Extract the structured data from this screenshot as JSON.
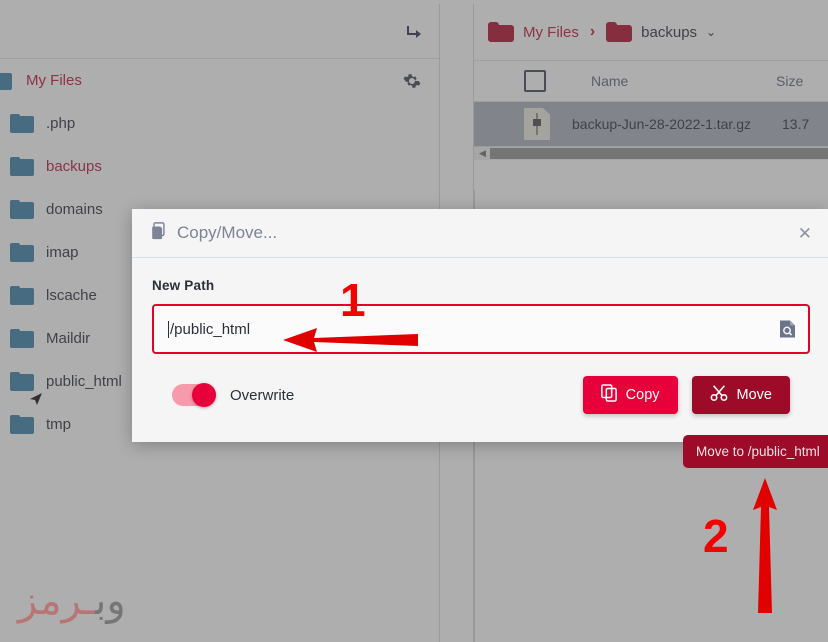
{
  "left_panel": {
    "collapse_icon": "arrow-turn-down-right-icon",
    "gear_icon": "gear-icon",
    "tree": [
      {
        "label": "My Files",
        "icon": "folder-icon",
        "style": "red",
        "root": true
      },
      {
        "label": ".php",
        "icon": "folder-icon",
        "style": "dark"
      },
      {
        "label": "backups",
        "icon": "folder-icon",
        "style": "red"
      },
      {
        "label": "domains",
        "icon": "folder-icon",
        "style": "dark"
      },
      {
        "label": "imap",
        "icon": "folder-icon",
        "style": "dark"
      },
      {
        "label": "lscache",
        "icon": "folder-icon",
        "style": "dark"
      },
      {
        "label": "Maildir",
        "icon": "folder-icon",
        "style": "dark"
      },
      {
        "label": "public_html",
        "icon": "folder-icon",
        "style": "dark"
      },
      {
        "label": "tmp",
        "icon": "folder-icon",
        "style": "dark"
      }
    ]
  },
  "right_panel": {
    "breadcrumb": {
      "root": "My Files",
      "separator": "›",
      "current": "backups",
      "caret": "⌄"
    },
    "table": {
      "headers": {
        "name": "Name",
        "size": "Size"
      },
      "rows": [
        {
          "name": "backup-Jun-28-2022-1.tar.gz",
          "size": "13.7",
          "icon": "archive-file-icon"
        }
      ]
    },
    "scrollbar_arrow": "◀"
  },
  "modal": {
    "title": "Copy/Move...",
    "title_icon": "copy-icon",
    "close_label": "✕",
    "path_label": "New Path",
    "path_value": "/public_html",
    "path_placeholder": "/public_html",
    "browse_icon": "file-search-icon",
    "overwrite_label": "Overwrite",
    "overwrite_on": true,
    "copy_label": "Copy",
    "copy_icon": "copy-icon",
    "move_label": "Move",
    "move_icon": "scissors-icon",
    "accent_copy": "#e8003a",
    "accent_move": "#9e0b28"
  },
  "tooltip": {
    "text": "Move to /public_html"
  },
  "annotations": {
    "step_one": "1",
    "step_two": "2",
    "color": "#f40000"
  },
  "watermark": {
    "part_dark": "وب",
    "part_red": "ـرمز"
  }
}
